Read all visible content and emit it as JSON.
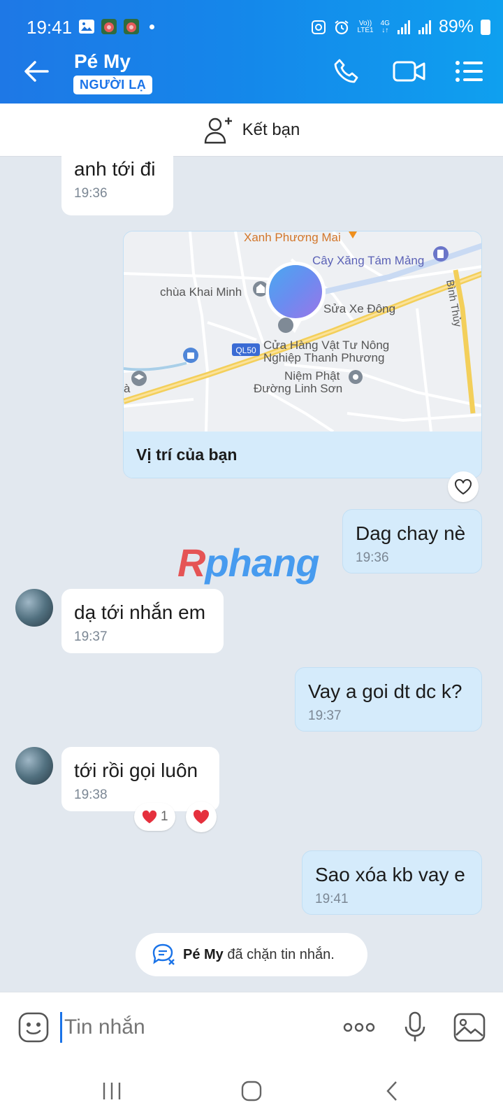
{
  "status_bar": {
    "time": "19:41",
    "volte": "Vo))",
    "lte": "LTE1",
    "net": "4G",
    "battery": "89%"
  },
  "header": {
    "contact_name": "Pé My",
    "tag": "NGƯỜI LẠ"
  },
  "add_friend": {
    "label": "Kết bạn"
  },
  "map": {
    "labels": {
      "xanh": "Xanh Phương Mai",
      "cayxang": "Cây Xăng Tám Mảng",
      "chua": "chùa Khai Minh",
      "suaxe": "Sửa Xe Đông",
      "binhthuy": "Bình Thủy",
      "ql50": "QL50",
      "cuahang1": "Cửa Hàng Vật Tư Nông",
      "cuahang2": "Nghiệp Thanh Phương",
      "niem1": "Niệm Phật",
      "niem2": "Đường Linh Sơn",
      "edge": "à"
    },
    "caption": "Vị trí của bạn"
  },
  "messages": [
    {
      "text": "anh tới đi",
      "time": "19:36"
    },
    {
      "text": "Dag chay nè",
      "time": "19:36"
    },
    {
      "text": "dạ tới nhắn em",
      "time": "19:37"
    },
    {
      "text": "Vay a goi dt dc k?",
      "time": "19:37"
    },
    {
      "text": "tới rồi gọi luôn",
      "time": "19:38",
      "reaction_count": "1"
    },
    {
      "text": "Sao xóa kb vay e",
      "time": "19:41"
    }
  ],
  "watermark": {
    "r": "R",
    "rest": "phang"
  },
  "system_message": {
    "name": "Pé My",
    "text": " đã chặn tin nhắn."
  },
  "input": {
    "placeholder": "Tin nhắn"
  },
  "colors": {
    "accent": "#1a73e8",
    "header_from": "#1e78e6",
    "header_to": "#0fa0ef",
    "outgoing_bubble": "#d5ebfb",
    "background": "#e2e8ef",
    "heart": "#e5303d"
  },
  "icons": [
    "back-arrow-icon",
    "phone-icon",
    "video-call-icon",
    "menu-list-icon",
    "add-friend-icon",
    "heart-outline-icon",
    "heart-icon",
    "chat-blocked-icon",
    "sticker-icon",
    "more-icon",
    "microphone-icon",
    "image-icon"
  ]
}
